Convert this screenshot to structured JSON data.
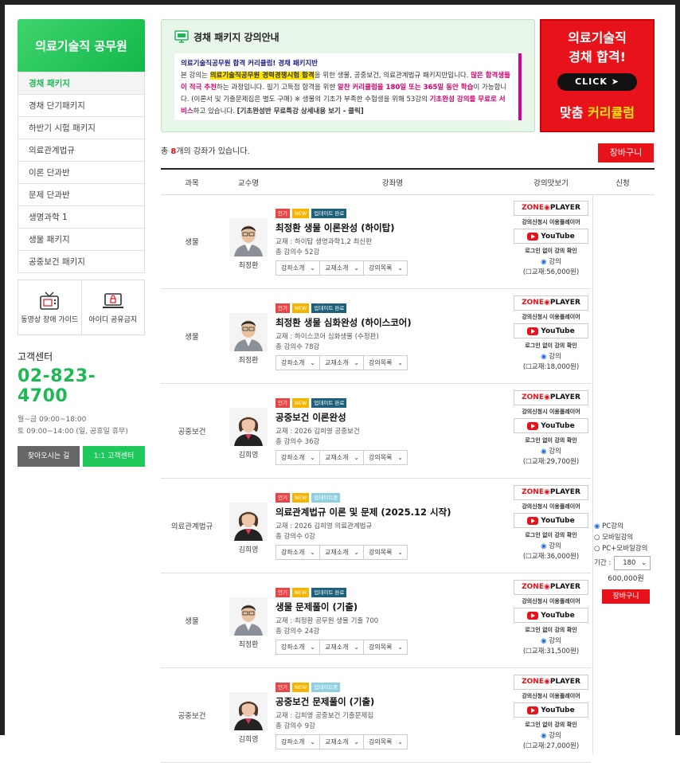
{
  "sidebar": {
    "title": "의료기술직 공무원",
    "items": [
      {
        "label": "경채 패키지",
        "active": true
      },
      {
        "label": "경채 단기패키지"
      },
      {
        "label": "하반기 시험 패키지"
      },
      {
        "label": "의료관계법규"
      },
      {
        "label": "이론 단과반"
      },
      {
        "label": "문제 단과반"
      },
      {
        "label": "생명과학 1"
      },
      {
        "label": "생물 패키지"
      },
      {
        "label": "공중보건 패키지"
      }
    ],
    "tools": [
      {
        "label": "동영상 장애 가이드",
        "icon": "tv-icon"
      },
      {
        "label": "아이디 공유금지",
        "icon": "laptop-lock-icon"
      }
    ],
    "cs": {
      "title": "고객센터",
      "phone": "02-823-4700",
      "hours1": "월~금 09:00~18:00",
      "hours2": "토 09:00~14:00 (일, 공휴일 휴무)",
      "btn_directions": "찾아오시는 길",
      "btn_support": "1:1 고객센터"
    }
  },
  "notice": {
    "title": "경채 패키지 강의안내",
    "line1": "의료기술직공무원 합격 커리큘럼! 경채 패키지반",
    "line2a": "본 강의는 ",
    "line2b": "의료기술직공무원 경력경쟁시험 합격",
    "line2c": "을 위한 생물, 공중보건, 의료관계법규 패키지반입니다. ",
    "line2d": "많은 합격생들이 적극 추천",
    "line2e": "하는 과정입니다. 필기 고득점 합격을 위한 ",
    "line2f": "알찬 커리큘럼을 180일 또는 365일 동안 학습",
    "line2g": "이 가능합니다. (이론서 및 기출문제집은 별도 구매) ※ 생물의 기초가 부족한 수험생을 위해 53강의 ",
    "line2h": "기초완성 강의를 무료로 서비스",
    "line2i": "하고 있습니다. ",
    "line2j": "[기초완성반 무료특강 상세내용 보기 - 클릭]"
  },
  "banner": {
    "line1": "의료기술직",
    "line2": "경채 합격!",
    "click": "CLICK",
    "line3a": "맞춤 ",
    "line3b": "커리큘럼"
  },
  "list": {
    "count_prefix": "총 ",
    "count": "8",
    "count_suffix": "개의 강좌가 있습니다.",
    "cart_label": "장바구니"
  },
  "table_headers": [
    "과목",
    "교수명",
    "강좌명",
    "강의맛보기",
    "신청"
  ],
  "tags": {
    "hot": "인기",
    "new": "NEW",
    "update_done": "업데이트 완료",
    "update_ing": "업데이트중"
  },
  "selects": [
    "강좌소개",
    "교재소개",
    "강의목록"
  ],
  "viewer": {
    "zone_a": "ZONE",
    "zone_b": "PLAYER",
    "zone_note": "강의신청시 이용플레이어",
    "youtube": "YouTube",
    "login_note": "로그인 없이 강의 확인",
    "lecture_option": "강의"
  },
  "courses": [
    {
      "subject": "생물",
      "professor": "최정환",
      "title": "최정환 생물 이론완성 (하이탑)",
      "textbook": "교재 : 하이탑 생명과학1,2 최신판",
      "lectures": "총 강의수 52강",
      "book_price": "교재:56,000원",
      "update": "done"
    },
    {
      "subject": "생물",
      "professor": "최정환",
      "title": "최정환 생물 심화완성 (하이스코어)",
      "textbook": "교재 : 하이스코어 심화생물 (수정판)",
      "lectures": "총 강의수 78강",
      "book_price": "교재:18,000원",
      "update": "done"
    },
    {
      "subject": "공중보건",
      "professor": "김희영",
      "title": "공중보건 이론완성",
      "textbook": "교재 : 2026 김희영 공중보건",
      "lectures": "총 강의수 36강",
      "book_price": "교재:29,700원",
      "update": "done"
    },
    {
      "subject": "의료관계법규",
      "professor": "김희영",
      "title": "의료관계법규 이론 및 문제 (2025.12 시작)",
      "textbook": "교재 : 2026 김희영 의료관계법규",
      "lectures": "총 강의수 0강",
      "book_price": "교재:36,000원",
      "update": "ing"
    },
    {
      "subject": "생물",
      "professor": "최정환",
      "title": "생물 문제풀이 (기출)",
      "textbook": "교재 : 최정환 공무원 생물 기출 700",
      "lectures": "총 강의수 24강",
      "book_price": "교재:31,500원",
      "update": "done"
    },
    {
      "subject": "공중보건",
      "professor": "김희영",
      "title": "공중보건 문제풀이 (기출)",
      "textbook": "교재 : 김희영 공중보건 기출문제집",
      "lectures": "총 강의수 9강",
      "book_price": "교재:27,000원",
      "update": "ing"
    }
  ],
  "apply": {
    "opt_pc": "PC강의",
    "opt_mobile": "모바일강의",
    "opt_both": "PC+모바일강의",
    "period_label": "기간 :",
    "period_value": "180",
    "price": "600,000원",
    "cart_label": "장바구니"
  }
}
